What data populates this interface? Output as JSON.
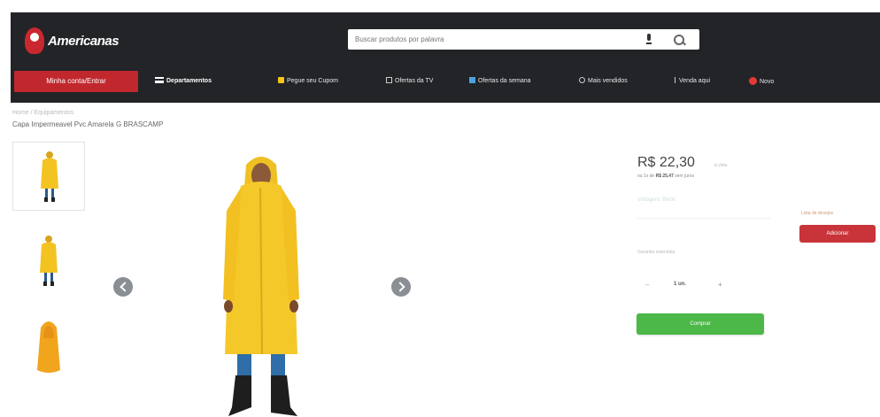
{
  "header": {
    "logo_text": "Americanas",
    "search_placeholder": "Buscar produtos por palavra",
    "login_button": "Minha conta/Entrar",
    "nav": {
      "departments": "Departamentos",
      "coupons": "Pegue seu Cupom",
      "tv": "Ofertas da TV",
      "offers": "Ofertas da semana",
      "best_sellers": "Mais vendidos",
      "sell": "Venda aqui",
      "new": "Novo"
    }
  },
  "breadcrumb": "Home / Equipamentos",
  "product": {
    "title": "Capa Impermeavel Pvc Amarela G BRASCAMP",
    "price": "R$ 22,30",
    "price_unit": "à vista",
    "installments_prefix": "ou 1x de",
    "installments_value": "R$ 25,47",
    "installments_suffix": "sem juros",
    "voltage_label": "Voltagem:",
    "voltage_value": "Bivolt",
    "warranty": "Garantia estendida",
    "compare_label": "Lista de desejos",
    "compare_button": "Adicionar",
    "quantity": "1 un.",
    "buy_button": "Comprar"
  },
  "colors": {
    "header_bg": "#222428",
    "accent_red": "#c0282e",
    "buy_green": "#4cb848",
    "raincoat_yellow": "#f5c518"
  },
  "icons": [
    "americanas-logo-icon",
    "microphone-icon",
    "search-icon",
    "menu-icon",
    "chevron-left-icon",
    "chevron-right-icon"
  ]
}
